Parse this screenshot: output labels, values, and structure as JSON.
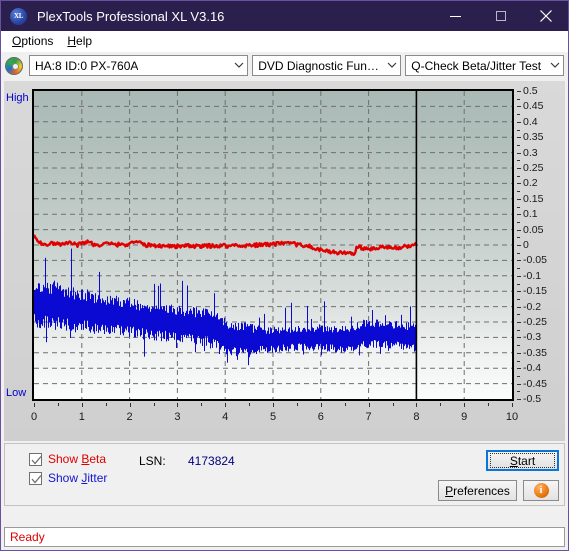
{
  "window": {
    "title": "PlexTools Professional XL V3.16",
    "app_icon": "xl-logo-icon",
    "minimize": "minimize-icon",
    "maximize": "maximize-icon",
    "close": "close-icon"
  },
  "menubar": {
    "items": [
      {
        "label": "Options",
        "accel": "O"
      },
      {
        "label": "Help",
        "accel": "H"
      }
    ]
  },
  "toolbar": {
    "disc_icon": "optical-disc-icon",
    "drive": {
      "value": "HA:8 ID:0  PX-760A",
      "chevron": "chevron-down-icon"
    },
    "function": {
      "value": "DVD Diagnostic Functions",
      "chevron": "chevron-down-icon"
    },
    "test": {
      "value": "Q-Check Beta/Jitter Test",
      "chevron": "chevron-down-icon"
    }
  },
  "chart_data": {
    "type": "line",
    "title": "Q-Check Beta/Jitter Test",
    "xlabel": "",
    "ylabel": "",
    "xlim": [
      0,
      10
    ],
    "ylim": [
      -0.5,
      0.5
    ],
    "xticks": [
      0,
      1,
      2,
      3,
      4,
      5,
      6,
      7,
      8,
      9,
      10
    ],
    "yticks": [
      0.5,
      0.45,
      0.4,
      0.35,
      0.3,
      0.25,
      0.2,
      0.15,
      0.1,
      0.05,
      0,
      -0.05,
      -0.1,
      -0.15,
      -0.2,
      -0.25,
      -0.3,
      -0.35,
      -0.4,
      -0.45,
      -0.5
    ],
    "ytick_labels": [
      "0.5",
      "0.45",
      "0.4",
      "0.35",
      "0.3",
      "0.25",
      "0.2",
      "0.15",
      "0.1",
      "0.05",
      "0",
      "-0.05",
      "-0.1",
      "-0.15",
      "-0.2",
      "-0.25",
      "-0.3",
      "-0.35",
      "-0.4",
      "-0.45",
      "-0.5"
    ],
    "axis_left_labels": {
      "top": "High",
      "bottom": "Low"
    },
    "grid": true,
    "legend": "none",
    "data_end_x": 8,
    "series": [
      {
        "name": "Beta",
        "color": "#e00000",
        "x": [
          0.0,
          0.1,
          0.2,
          0.35,
          0.5,
          0.7,
          0.9,
          1.1,
          1.3,
          1.5,
          1.7,
          1.9,
          2.1,
          2.3,
          2.5,
          2.7,
          2.9,
          3.1,
          3.3,
          3.5,
          3.7,
          3.9,
          4.1,
          4.3,
          4.5,
          4.7,
          4.9,
          5.1,
          5.3,
          5.5,
          5.7,
          5.9,
          6.1,
          6.3,
          6.5,
          6.7,
          6.75,
          6.9,
          7.1,
          7.3,
          7.5,
          7.7,
          7.9,
          8.0
        ],
        "y": [
          0.03,
          0.008,
          0.002,
          0.006,
          0.002,
          0.01,
          0.0,
          0.012,
          -0.002,
          0.004,
          0.002,
          0.0,
          0.014,
          0.0,
          -0.002,
          -0.002,
          -0.004,
          -0.003,
          -0.004,
          -0.004,
          -0.003,
          -0.002,
          -0.002,
          -0.002,
          -0.001,
          0.0,
          0.002,
          0.004,
          0.004,
          0.002,
          -0.002,
          -0.014,
          -0.02,
          -0.024,
          -0.026,
          -0.03,
          -0.004,
          -0.012,
          -0.014,
          -0.006,
          -0.01,
          -0.006,
          -0.002,
          0.0
        ],
        "band": 0.006
      },
      {
        "name": "Jitter",
        "color": "#0a0ad2",
        "x": [
          0.0,
          0.2,
          0.4,
          0.6,
          0.8,
          1.0,
          1.2,
          1.4,
          1.6,
          1.8,
          2.0,
          2.2,
          2.4,
          2.6,
          2.8,
          3.0,
          3.2,
          3.4,
          3.6,
          3.8,
          3.95,
          4.0,
          4.2,
          4.4,
          4.6,
          4.8,
          5.0,
          5.2,
          5.4,
          5.6,
          5.8,
          6.0,
          6.2,
          6.4,
          6.6,
          6.75,
          6.9,
          7.1,
          7.3,
          7.5,
          7.7,
          7.9,
          8.0
        ],
        "y_top": [
          -0.13,
          -0.14,
          -0.132,
          -0.145,
          -0.15,
          -0.155,
          -0.165,
          -0.17,
          -0.175,
          -0.18,
          -0.185,
          -0.19,
          -0.195,
          -0.2,
          -0.205,
          -0.208,
          -0.212,
          -0.215,
          -0.22,
          -0.23,
          -0.236,
          -0.25,
          -0.258,
          -0.264,
          -0.268,
          -0.272,
          -0.274,
          -0.272,
          -0.27,
          -0.268,
          -0.266,
          -0.268,
          -0.27,
          -0.272,
          -0.274,
          -0.258,
          -0.252,
          -0.25,
          -0.254,
          -0.256,
          -0.258,
          -0.262,
          -0.266
        ],
        "y_bottom": [
          -0.25,
          -0.255,
          -0.258,
          -0.262,
          -0.266,
          -0.268,
          -0.272,
          -0.276,
          -0.278,
          -0.282,
          -0.286,
          -0.29,
          -0.294,
          -0.298,
          -0.3,
          -0.304,
          -0.308,
          -0.312,
          -0.316,
          -0.33,
          -0.352,
          -0.36,
          -0.352,
          -0.348,
          -0.344,
          -0.342,
          -0.34,
          -0.338,
          -0.336,
          -0.334,
          -0.334,
          -0.336,
          -0.338,
          -0.34,
          -0.342,
          -0.33,
          -0.326,
          -0.324,
          -0.326,
          -0.328,
          -0.33,
          -0.334,
          -0.338
        ]
      }
    ]
  },
  "controls": {
    "show_beta": {
      "label_prefix": "Show ",
      "label_accel": "B",
      "label_rest": "eta",
      "checked": true,
      "icon": "checkmark-icon"
    },
    "show_jitter": {
      "label_prefix": "Show ",
      "label_accel": "J",
      "label_rest": "itter",
      "checked": true,
      "icon": "checkmark-icon"
    },
    "lsn_label": "LSN:",
    "lsn_value": "4173824",
    "start_button": {
      "prefix": "",
      "accel": "S",
      "rest": "tart",
      "focused": true
    },
    "preferences_button": {
      "prefix": "",
      "accel": "P",
      "rest": "references"
    },
    "info_button": {
      "icon": "info-icon",
      "glyph": "i"
    }
  },
  "statusbar": {
    "text": "Ready"
  }
}
